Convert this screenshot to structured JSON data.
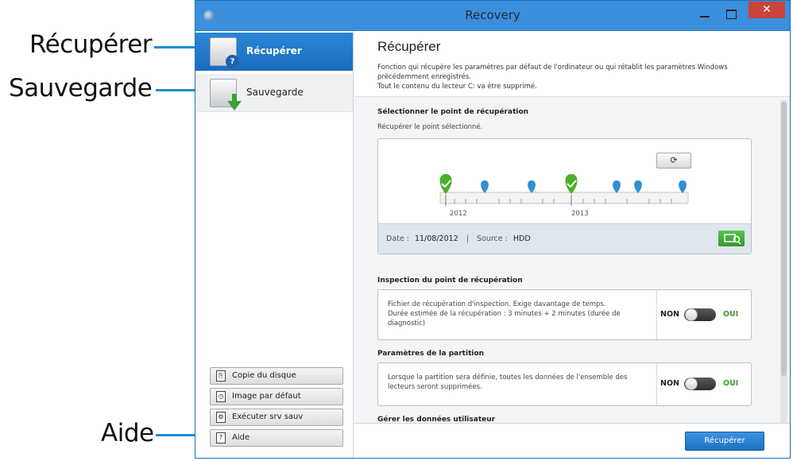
{
  "callouts": {
    "recuperer": "Récupérer",
    "sauvegarde": "Sauvegarde",
    "aide": "Aide"
  },
  "window": {
    "title": "Recovery",
    "close_glyph": "✕"
  },
  "sidebar": {
    "items": [
      {
        "label": "Récupérer",
        "icon": "recover-icon",
        "active": true
      },
      {
        "label": "Sauvegarde",
        "icon": "backup-icon",
        "active": false
      }
    ],
    "buttons": [
      {
        "label": "Copie du disque",
        "icon": "copy-disk-icon"
      },
      {
        "label": "Image par défaut",
        "icon": "default-image-icon"
      },
      {
        "label": "Exécuter srv sauv",
        "icon": "run-backup-server-icon"
      },
      {
        "label": "Aide",
        "icon": "help-icon"
      }
    ]
  },
  "main": {
    "title": "Récupérer",
    "description_lines": [
      "Fonction qui récupère les paramètres par défaut de l'ordinateur ou qui rétablit les paramètres Windows",
      "précédemment enregistrés.",
      "Tout le contenu du lecteur C: va être supprimé."
    ],
    "section1": {
      "title": "Sélectionner le point de récupération",
      "subtitle": "Récupérer le point sélectionné."
    },
    "timeline": {
      "years": [
        "2012",
        "2013"
      ],
      "date_label": "Date :",
      "date_value": "11/08/2012",
      "separator": "|",
      "source_label": "Source :",
      "source_value": "HDD"
    },
    "section2": {
      "title": "Inspection du point de récupération",
      "text_lines": [
        "Fichier de récupération d'inspection. Exige davantage de temps.",
        "Durée estimée de la récupération : 3 minutes + 2 minutes (durée de",
        "diagnostic)"
      ],
      "non": "NON",
      "oui": "OUI"
    },
    "section3": {
      "title": "Paramètres de la partition",
      "text_lines": [
        "Lorsque la partition sera définie, toutes les données de l'ensemble des",
        "lecteurs seront supprimées."
      ],
      "non": "NON",
      "oui": "OUI"
    },
    "section4": {
      "title": "Gérer les données utilisateur"
    },
    "primary_button": "Récupérer"
  },
  "colors": {
    "accent": "#1a6cbd",
    "callout": "#1a8fd6",
    "success": "#3a9d2e",
    "pin_blue": "#2f8fd8",
    "pin_green": "#4caf2a"
  }
}
